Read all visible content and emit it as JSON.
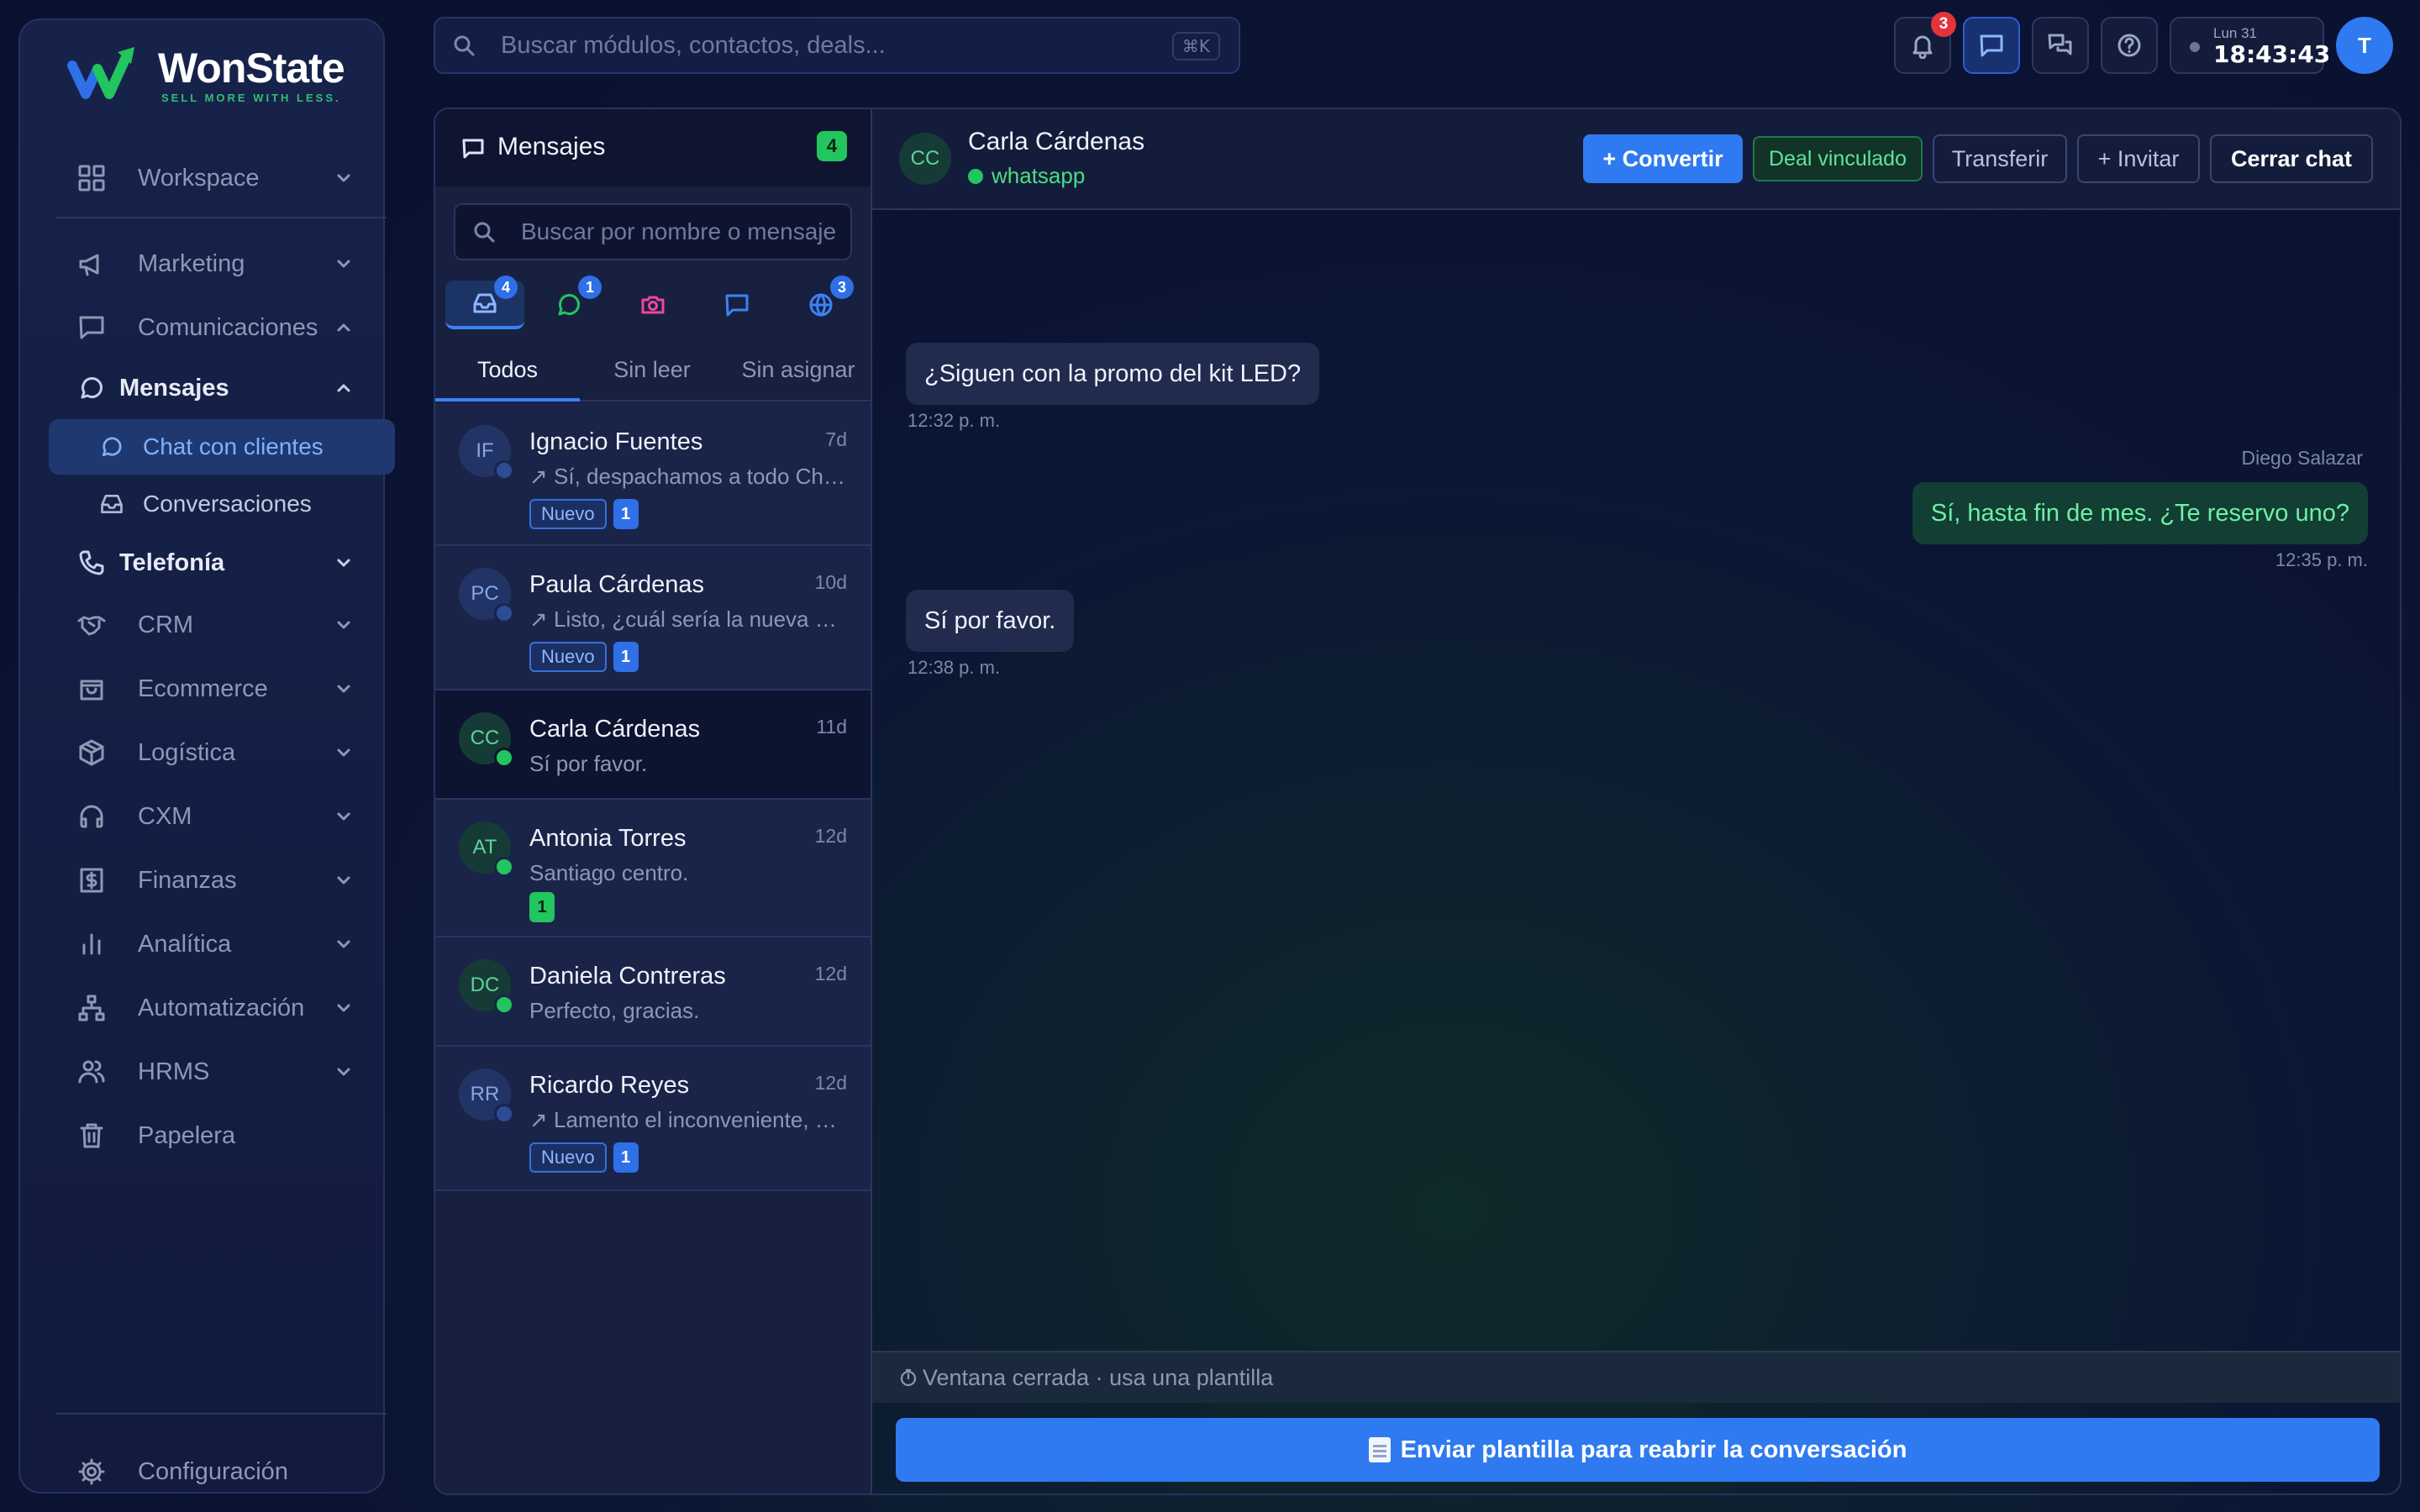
{
  "brand": {
    "name": "WonState",
    "tagline": "SELL MORE WITH LESS."
  },
  "sidebar": {
    "items": [
      {
        "label": "Workspace",
        "icon": "grid-icon"
      },
      {
        "label": "Marketing",
        "icon": "megaphone-icon"
      },
      {
        "label": "Comunicaciones",
        "icon": "message-square-icon"
      },
      {
        "label": "Mensajes",
        "icon": "message-circle-icon"
      },
      {
        "label": "Chat con clientes",
        "icon": "message-circle-icon"
      },
      {
        "label": "Conversaciones",
        "icon": "inbox-icon"
      },
      {
        "label": "Telefonía",
        "icon": "phone-icon"
      },
      {
        "label": "CRM",
        "icon": "handshake-icon"
      },
      {
        "label": "Ecommerce",
        "icon": "shopping-bag-icon"
      },
      {
        "label": "Logística",
        "icon": "package-icon"
      },
      {
        "label": "CXM",
        "icon": "headphones-icon"
      },
      {
        "label": "Finanzas",
        "icon": "dollar-icon"
      },
      {
        "label": "Analítica",
        "icon": "bar-chart-icon"
      },
      {
        "label": "Automatización",
        "icon": "network-icon"
      },
      {
        "label": "HRMS",
        "icon": "users-icon"
      },
      {
        "label": "Papelera",
        "icon": "trash-icon"
      }
    ],
    "settings": "Configuración"
  },
  "topbar": {
    "search_placeholder": "Buscar módulos, contactos, deals...",
    "shortcut": "⌘K",
    "notifications_count": "3",
    "clock_day": "Lun 31",
    "clock_time": "18:43:43",
    "user_initial": "T"
  },
  "inbox": {
    "title": "Mensajes",
    "unread_total": "4",
    "search_placeholder": "Buscar por nombre o mensaje",
    "channels": [
      {
        "name": "inbox",
        "badge": "4",
        "color": "#8fb6ff"
      },
      {
        "name": "whatsapp",
        "badge": "1",
        "color": "#22c55e"
      },
      {
        "name": "instagram",
        "badge": "",
        "color": "#ec4899"
      },
      {
        "name": "messenger",
        "badge": "",
        "color": "#3b82f6"
      },
      {
        "name": "web",
        "badge": "3",
        "color": "#3b82f6"
      }
    ],
    "tabs": [
      "Todos",
      "Sin leer",
      "Sin asignar"
    ],
    "new_tag": "Nuevo",
    "conversations": [
      {
        "initials": "IF",
        "name": "Ignacio Fuentes",
        "ago": "7d",
        "preview": "↗ Sí, despachamos a todo Chile.",
        "channel": "web",
        "tag": "Nuevo",
        "count": "1"
      },
      {
        "initials": "PC",
        "name": "Paula Cárdenas",
        "ago": "10d",
        "preview": "↗ Listo, ¿cuál sería la nueva dirección?",
        "channel": "web",
        "tag": "Nuevo",
        "count": "1"
      },
      {
        "initials": "CC",
        "name": "Carla Cárdenas",
        "ago": "11d",
        "preview": "Sí por favor.",
        "channel": "whatsapp",
        "tag": "",
        "count": ""
      },
      {
        "initials": "AT",
        "name": "Antonia Torres",
        "ago": "12d",
        "preview": "Santiago centro.",
        "channel": "whatsapp",
        "tag": "",
        "count": "1"
      },
      {
        "initials": "DC",
        "name": "Daniela Contreras",
        "ago": "12d",
        "preview": "Perfecto, gracias.",
        "channel": "whatsapp",
        "tag": "",
        "count": ""
      },
      {
        "initials": "RR",
        "name": "Ricardo Reyes",
        "ago": "12d",
        "preview": "↗ Lamento el inconveniente, ¿revisamos tu pedido?",
        "channel": "web",
        "tag": "Nuevo",
        "count": "1"
      }
    ]
  },
  "chat": {
    "contact_initials": "CC",
    "contact_name": "Carla Cárdenas",
    "channel": "whatsapp",
    "buttons": {
      "convert": "+ Convertir",
      "deal": "Deal vinculado",
      "transfer": "Transferir",
      "invite": "+ Invitar",
      "close": "Cerrar chat"
    },
    "messages": [
      {
        "dir": "in",
        "text": "¿Siguen con la promo del kit LED?",
        "time": "12:32 p. m."
      },
      {
        "dir": "out",
        "sender": "Diego Salazar",
        "text": "Sí, hasta fin de mes. ¿Te reservo uno?",
        "time": "12:35 p. m."
      },
      {
        "dir": "in",
        "text": "Sí por favor.",
        "time": "12:38 p. m."
      }
    ],
    "window_notice": "Ventana cerrada · usa una plantilla",
    "template_button": "Enviar plantilla para reabrir la conversación"
  }
}
